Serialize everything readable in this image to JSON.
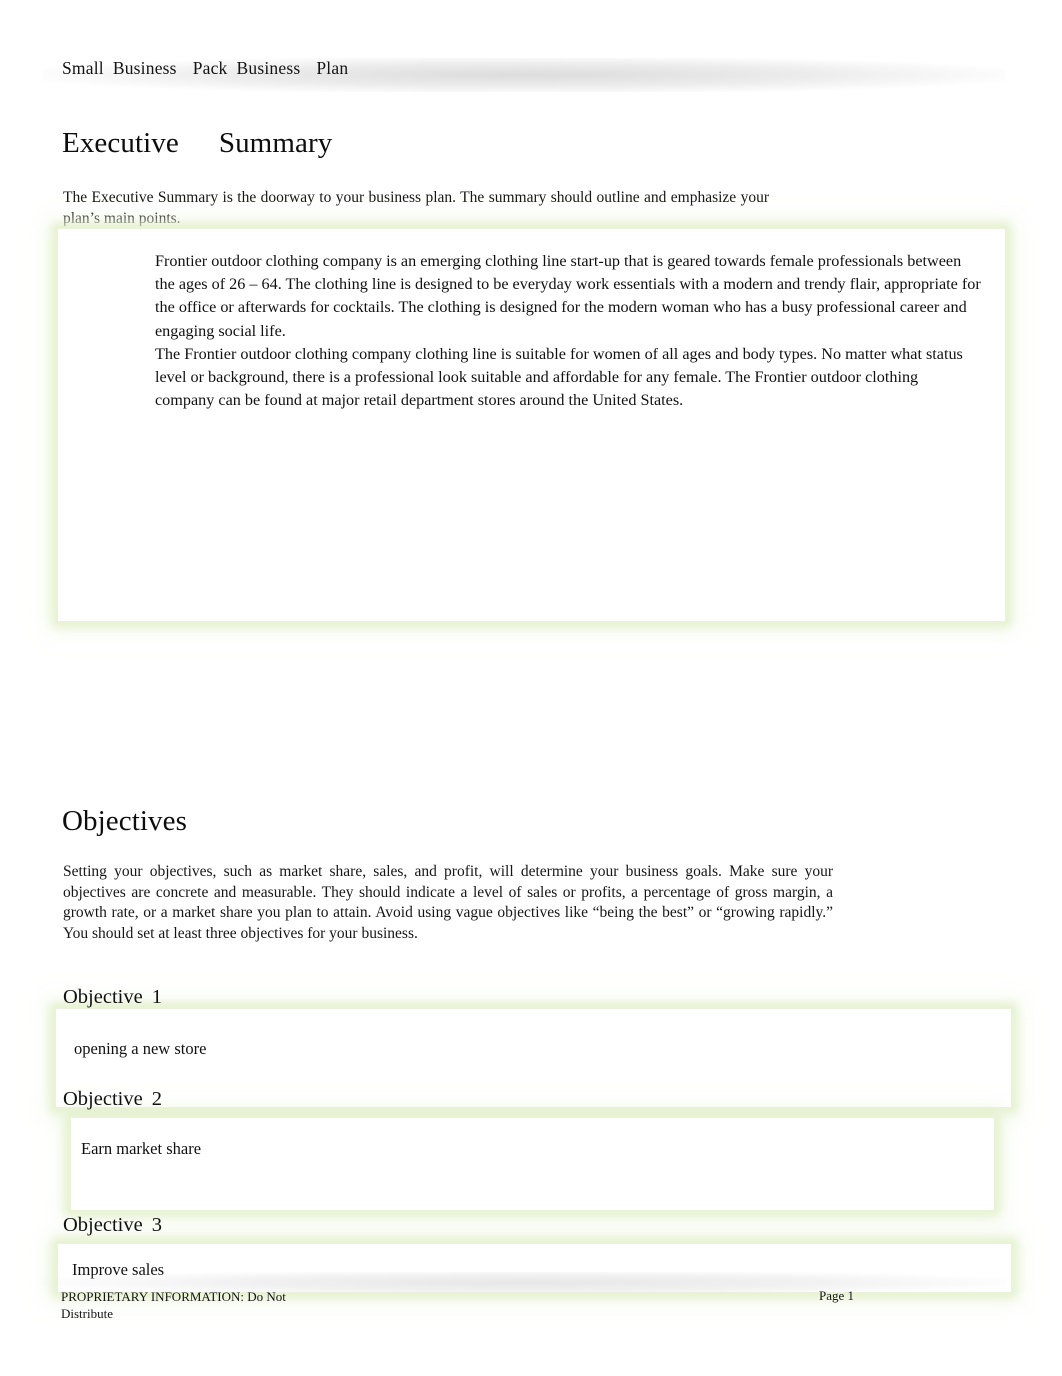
{
  "document": {
    "header": {
      "title_words": [
        "Small",
        "Business",
        "Pack",
        "Business",
        "Plan"
      ],
      "title_full": "Small  Business   Pack Business   Plan"
    },
    "sections": [
      {
        "heading_part1": "Executive",
        "heading_part2": "Summary",
        "intro": "The Executive Summary is the doorway to your business plan. The summary should outline and emphasize your plan’s main points.",
        "answer_paragraphs": [
          "Frontier outdoor clothing company is an emerging clothing line start-up that is geared towards female professionals between the ages of 26 – 64. The clothing line is designed to be everyday work essentials with a modern and trendy flair, appropriate for the office or afterwards for cocktails. The clothing is designed for the modern woman who has a busy professional career and engaging social life.",
          "The Frontier outdoor clothing company clothing line is suitable for women of all ages and body types. No matter what status level or background, there is a professional look suitable and affordable for any female. The Frontier outdoor clothing company can be found at major retail department stores around the United States."
        ]
      },
      {
        "heading_part1": "Objectives",
        "heading_part2": "",
        "intro": "Setting your objectives, such as market share, sales, and profit, will determine your business goals. Make sure your objectives are concrete and measurable. They should indicate a level of sales or profits, a percentage of gross margin, a growth rate, or a market share you plan to attain. Avoid using vague objectives like “being the best” or “growing rapidly.” You should set at least three objectives for your business.",
        "objectives": [
          {
            "label_text": "Objective",
            "label_number": "1",
            "value": "opening a new store"
          },
          {
            "label_text": "Objective",
            "label_number": "2",
            "value": "Earn market share"
          },
          {
            "label_text": "Objective",
            "label_number": "3",
            "value": "Improve sales"
          }
        ]
      }
    ],
    "footer": {
      "notice": "PROPRIETARY INFORMATION: Do Not Distribute",
      "page_label": "Page 1"
    },
    "colors": {
      "accent_glow": "#dceec4",
      "band_gray": "#e2e2e2",
      "text": "#111111",
      "page_background": "#ffffff"
    }
  }
}
